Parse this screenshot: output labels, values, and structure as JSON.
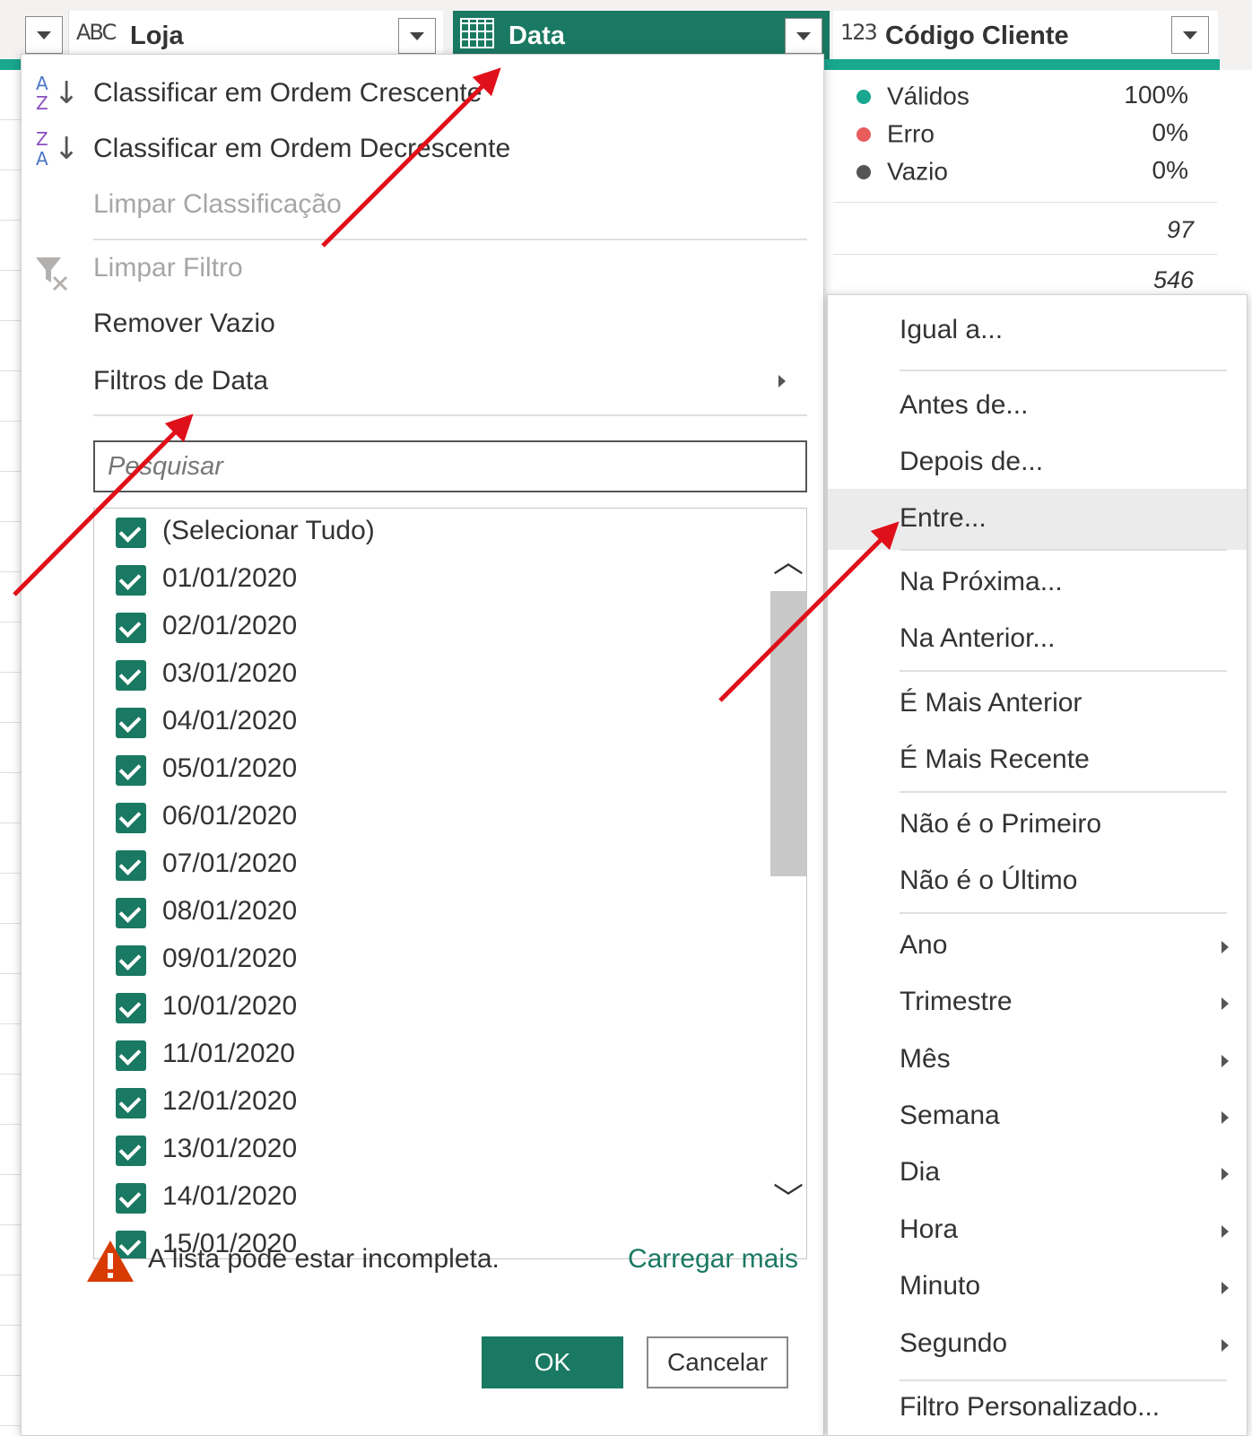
{
  "columns": {
    "loja": {
      "type_icon": "ABC",
      "title": "Loja"
    },
    "data": {
      "title": "Data"
    },
    "codigo": {
      "type_icon": "123",
      "title": "Código Cliente"
    }
  },
  "profile": {
    "valid_label": "Válidos",
    "valid_value": "100%",
    "error_label": "Erro",
    "error_value": "0%",
    "empty_label": "Vazio",
    "empty_value": "0%",
    "colors": {
      "valid": "#1aa78f",
      "error": "#e85c5c",
      "empty": "#555555"
    }
  },
  "cells": [
    "97",
    "546"
  ],
  "menu": {
    "sort_asc": "Classificar em Ordem Crescente",
    "sort_desc": "Classificar em Ordem Decrescente",
    "clear_sort": "Limpar Classificação",
    "clear_filter": "Limpar Filtro",
    "remove_empty": "Remover Vazio",
    "date_filters": "Filtros de Data",
    "search_placeholder": "Pesquisar",
    "select_all": "(Selecionar Tudo)",
    "dates": [
      "01/01/2020",
      "02/01/2020",
      "03/01/2020",
      "04/01/2020",
      "05/01/2020",
      "06/01/2020",
      "07/01/2020",
      "08/01/2020",
      "09/01/2020",
      "10/01/2020",
      "11/01/2020",
      "12/01/2020",
      "13/01/2020",
      "14/01/2020",
      "15/01/2020"
    ],
    "warning": "A lista pode estar incompleta.",
    "load_more": "Carregar mais",
    "ok": "OK",
    "cancel": "Cancelar"
  },
  "submenu": {
    "equal": "Igual a...",
    "before": "Antes de...",
    "after": "Depois de...",
    "between": "Entre...",
    "next": "Na Próxima...",
    "previous": "Na Anterior...",
    "earliest": "É Mais Anterior",
    "latest": "É Mais Recente",
    "not_first": "Não é o Primeiro",
    "not_last": "Não é o Último",
    "year": "Ano",
    "quarter": "Trimestre",
    "month": "Mês",
    "week": "Semana",
    "day": "Dia",
    "hour": "Hora",
    "minute": "Minuto",
    "second": "Segundo",
    "custom": "Filtro Personalizado..."
  },
  "accent": "#1a7962",
  "annotation_color": "#e0101a"
}
